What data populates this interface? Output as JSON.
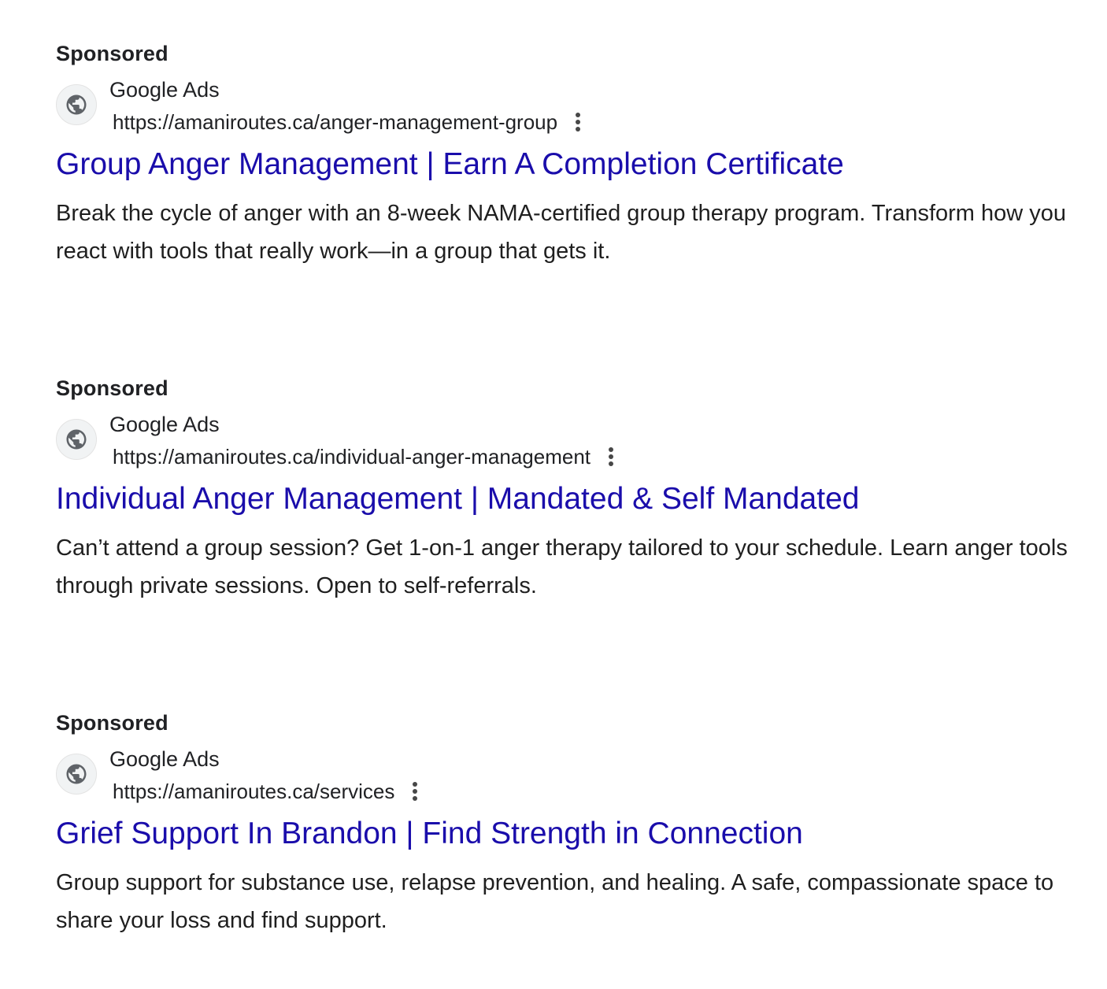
{
  "ads": [
    {
      "sponsored_label": "Sponsored",
      "advertiser": "Google Ads",
      "url": "https://amaniroutes.ca/anger-management-group",
      "headline": "Group Anger Management | Earn A Completion Certificate",
      "description": "Break the cycle of anger with an 8-week NAMA-certified group therapy program. Transform how you react with tools that really work—in a group that gets it.",
      "icon": "globe-icon",
      "menu_icon": "more-vert-icon"
    },
    {
      "sponsored_label": "Sponsored",
      "advertiser": "Google Ads",
      "url": "https://amaniroutes.ca/individual-anger-management",
      "headline": "Individual Anger Management | Mandated & Self Mandated",
      "description": "Can’t attend a group session? Get 1-on-1 anger therapy tailored to your schedule. Learn anger tools through private sessions. Open to self-referrals.",
      "icon": "globe-icon",
      "menu_icon": "more-vert-icon"
    },
    {
      "sponsored_label": "Sponsored",
      "advertiser": "Google Ads",
      "url": "https://amaniroutes.ca/services",
      "headline": "Grief Support In Brandon | Find Strength in Connection",
      "description": "Group support for substance use, relapse prevention, and healing. A safe, compassionate space to share your loss and find support.",
      "icon": "globe-icon",
      "menu_icon": "more-vert-icon"
    }
  ],
  "colors": {
    "headline_link": "#1a0dab",
    "body_text": "#1f1f1f",
    "favicon_bg": "#f1f3f4",
    "icon_gray": "#5f6368"
  }
}
